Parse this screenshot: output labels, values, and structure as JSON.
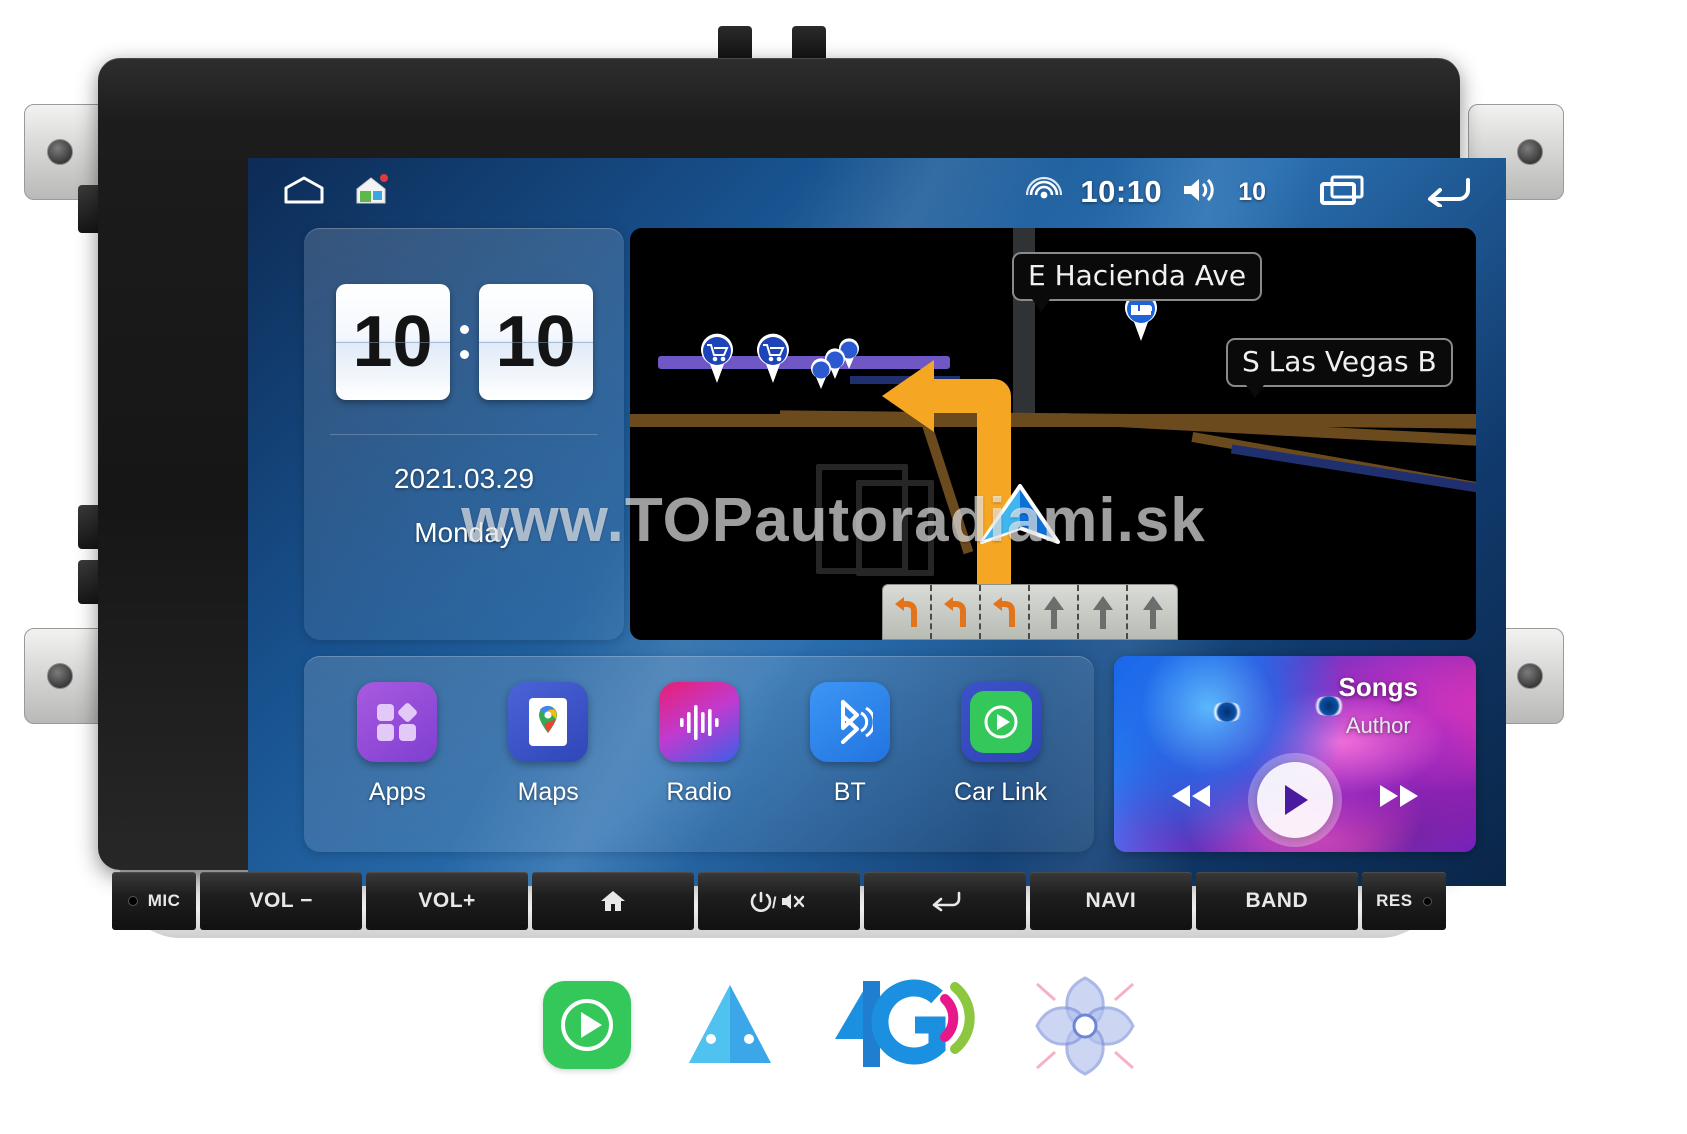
{
  "product": {
    "type": "android-car-head-unit",
    "watermark": "www.TOPautoradiami.sk"
  },
  "statusbar": {
    "home_icon": "home-outline-icon",
    "launcher_icon": "house-app-icon",
    "signal_icon": "wifi-signal-icon",
    "time": "10:10",
    "volume_icon": "volume-icon",
    "volume_level": "10",
    "recents_icon": "recent-apps-icon",
    "back_icon": "back-arrow-icon"
  },
  "clock_widget": {
    "hours": "10",
    "minutes": "10",
    "date": "2021.03.29",
    "weekday": "Monday"
  },
  "map_widget": {
    "street_labels": [
      {
        "text": "E Hacienda Ave"
      },
      {
        "text": "S Las Vegas B"
      }
    ],
    "pois": [
      {
        "icon": "shopping-cart-pin"
      },
      {
        "icon": "shopping-cart-pin"
      },
      {
        "icon": "generic-pin"
      },
      {
        "icon": "generic-pin"
      },
      {
        "icon": "generic-pin"
      },
      {
        "icon": "hotel-bed-pin"
      }
    ],
    "maneuver_icon": "left-turn-arrow",
    "position_icon": "navigation-position-arrow",
    "lane_guidance": [
      "left",
      "left",
      "left",
      "straight",
      "straight",
      "straight"
    ],
    "colors": {
      "route": "#6f57c6",
      "maneuver": "#f5a623",
      "road": "#6b4a1e",
      "background": "#000000"
    }
  },
  "apps": [
    {
      "label": "Apps",
      "icon": "apps-grid-icon",
      "color": "#9b4fd8"
    },
    {
      "label": "Maps",
      "icon": "google-maps-icon",
      "color": "#3c55c9"
    },
    {
      "label": "Radio",
      "icon": "radio-wave-icon",
      "color": "#e0278c"
    },
    {
      "label": "BT",
      "icon": "bluetooth-icon",
      "color": "#2b86f0"
    },
    {
      "label": "Car Link",
      "icon": "car-link-icon",
      "color": "#33c44b"
    }
  ],
  "music_widget": {
    "title": "Songs",
    "author": "Author",
    "prev_icon": "rewind-icon",
    "play_icon": "play-icon",
    "next_icon": "fast-forward-icon"
  },
  "hardware_buttons": [
    {
      "label": "MIC",
      "type": "label"
    },
    {
      "label": "VOL −",
      "type": "button"
    },
    {
      "label": "VOL+",
      "type": "button"
    },
    {
      "label": "",
      "type": "icon",
      "icon": "home-icon"
    },
    {
      "label": "",
      "type": "icon",
      "icon": "power-mute-icon"
    },
    {
      "label": "",
      "type": "icon",
      "icon": "back-icon"
    },
    {
      "label": "NAVI",
      "type": "button"
    },
    {
      "label": "BAND",
      "type": "button"
    },
    {
      "label": "RES",
      "type": "label"
    }
  ],
  "feature_logos": [
    {
      "name": "carplay-logo",
      "label": "CarPlay"
    },
    {
      "name": "android-auto-logo",
      "label": "Android Auto"
    },
    {
      "name": "4g-logo",
      "label": "4G"
    },
    {
      "name": "dsp-fan-logo",
      "label": "DSP"
    }
  ]
}
